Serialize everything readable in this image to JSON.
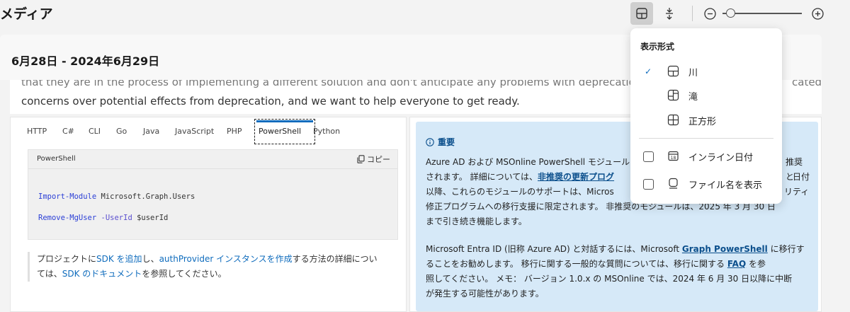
{
  "header": {
    "title": "メディア"
  },
  "date_range": "6月28日 - 2024年6月29日",
  "article": {
    "faded_line": "that they are in the process of implementing a different solution and don't anticipate any problems with deprecation.",
    "faded_tail": "cated",
    "line": "concerns over potential effects from deprecation, and we want to help everyone to get ready."
  },
  "code_panel": {
    "tabs": [
      "HTTP",
      "C#",
      "CLI",
      "Go",
      "Java",
      "JavaScript",
      "PHP",
      "PowerShell",
      "Python"
    ],
    "active_tab": "PowerShell",
    "code_language": "PowerShell",
    "copy_label": "コピー",
    "code": {
      "line1_cmd": "Import-Module",
      "line1_arg": " Microsoft.Graph.Users",
      "line2_cmd": "Remove-MgUser",
      "line2_param": " -UserId",
      "line2_arg": " $userId"
    },
    "note": {
      "p1": "プロジェクトに",
      "link1": "SDK を追加",
      "p2": "し、",
      "link2": "authProvider インスタンスを作成",
      "p3": "する方法の詳細につい",
      "p4": "ては、",
      "link3": "SDK のドキュメント",
      "p5": "を参照してください。"
    }
  },
  "important": {
    "title": "重要",
    "para1": {
      "l1": "Azure AD および MSOnline PowerShell モジュール",
      "l1_tail": "推奨と",
      "l2a": "されます。 詳細については、",
      "l2_link": "非推奨の更新プログ",
      "l2_tail": "日付",
      "l3": "以降、これらのモジュールのサポートは、Micros",
      "l3_tail": "リティ",
      "l4": "修正プログラムへの移行支援に限定されます。 非推奨のモジュールは、2025 年 3 月 30 日",
      "l5": "まで引き続き機能します。"
    },
    "para2": {
      "l1a": "Microsoft Entra ID (旧称 Azure AD) と対話するには、Microsoft ",
      "l1_link": "Graph PowerShell",
      "l1b": " に移行す",
      "l2a": "ることをお勧めします。 移行に関する一般的な質問については、移行に関する ",
      "l2_link": "FAQ",
      "l2b": " を参",
      "l3": "照してください。 メモ： バージョン 1.0.x の MSOnline では、2024 年 6 月 30 日以降に中断",
      "l4": "が発生する可能性があります。"
    }
  },
  "dropdown": {
    "title": "表示形式",
    "items": [
      {
        "label": "川",
        "checked": true
      },
      {
        "label": "滝",
        "checked": false
      },
      {
        "label": "正方形",
        "checked": false
      }
    ],
    "options": [
      {
        "label": "インライン日付",
        "checked": false
      },
      {
        "label": "ファイル名を表示",
        "checked": false
      }
    ]
  },
  "icons": [
    "layout-icon",
    "expand-vertical-icon",
    "zoom-out-icon",
    "zoom-in-icon",
    "copy-icon",
    "info-icon",
    "checkmark-icon",
    "river-layout-icon",
    "waterfall-layout-icon",
    "square-layout-icon",
    "calendar-icon",
    "file-name-icon"
  ],
  "colors": {
    "accent": "#0f6cbd",
    "important_bg": "#d6e9f8"
  }
}
